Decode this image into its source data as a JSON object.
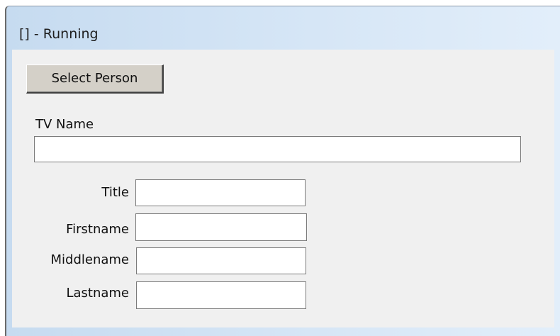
{
  "window": {
    "title": "[] - Running"
  },
  "form": {
    "select_person_label": "Select Person",
    "tv_name_label": "TV Name",
    "tv_name_value": "",
    "fields": {
      "title": {
        "label": "Title",
        "value": ""
      },
      "firstname": {
        "label": "Firstname",
        "value": ""
      },
      "middlename": {
        "label": "Middlename",
        "value": ""
      },
      "lastname": {
        "label": "Lastname",
        "value": ""
      }
    }
  },
  "colors": {
    "titlebar_gradient_start": "#c6dbf0",
    "titlebar_gradient_end": "#e2eefa",
    "client_background": "#f0f0f0",
    "button_face": "#d4d0c8"
  }
}
